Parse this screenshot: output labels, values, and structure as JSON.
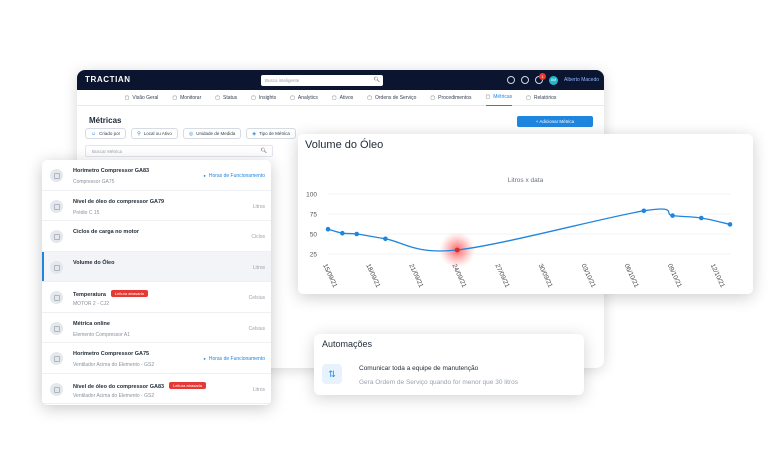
{
  "topbar": {
    "logo": "TRACTIAN",
    "search_placeholder": "Busca inteligente",
    "notifications_badge": "1",
    "avatar_initials": "AM",
    "user_name": "Alberto Macedo"
  },
  "nav": {
    "items": [
      {
        "label": "Visão Geral",
        "icon": "monitor-icon"
      },
      {
        "label": "Monitorar",
        "icon": "eye-icon"
      },
      {
        "label": "Status",
        "icon": "status-icon"
      },
      {
        "label": "Insights",
        "icon": "insights-icon"
      },
      {
        "label": "Analytics",
        "icon": "analytics-icon"
      },
      {
        "label": "Ativos",
        "icon": "assets-icon"
      },
      {
        "label": "Ordens de Serviço",
        "icon": "work-order-icon"
      },
      {
        "label": "Procedimentos",
        "icon": "list-icon"
      },
      {
        "label": "Métricas",
        "icon": "metrics-icon"
      },
      {
        "label": "Relatórios",
        "icon": "reports-icon"
      }
    ],
    "active_index": 8
  },
  "metrics_page": {
    "title": "Métricas",
    "add_button": "+ Adicionar Métrica",
    "filters": [
      "Criado por",
      "Local ou Ativo",
      "Unidade de Medida",
      "Tipo de Métrica"
    ],
    "search_placeholder": "Buscar Métrica"
  },
  "metric_list": [
    {
      "title": "Horímetro Compressor GA83",
      "subtitle": "Compressor GA75",
      "unit": "Horas de Funcionamento",
      "unit_is_link": true,
      "tag": ""
    },
    {
      "title": "Nível de óleo do compressor GA79",
      "subtitle": "Prédio C 15",
      "unit": "Litros",
      "unit_is_link": false,
      "tag": ""
    },
    {
      "title": "Ciclos de carga no motor",
      "subtitle": "",
      "unit": "Ciclos",
      "unit_is_link": false,
      "tag": ""
    },
    {
      "title": "Volume do Óleo",
      "subtitle": "",
      "unit": "Litros",
      "unit_is_link": false,
      "tag": "",
      "active": true
    },
    {
      "title": "Temperatura",
      "subtitle": "MOTOR 2 - CJ2",
      "unit": "Celsius",
      "unit_is_link": false,
      "tag": "Leitura atrasada"
    },
    {
      "title": "Métrica online",
      "subtitle": "Elemento Compressor A1",
      "unit": "Celsius",
      "unit_is_link": false,
      "tag": ""
    },
    {
      "title": "Horímetro Compressor GA75",
      "subtitle": "Ventilador Acima do Elemento - GS2",
      "unit": "Horas de Funcionamento",
      "unit_is_link": true,
      "tag": ""
    },
    {
      "title": "Nível de óleo do compressor GA83",
      "subtitle": "Ventilador Acima do Elemento - GS2",
      "unit": "Litros",
      "unit_is_link": false,
      "tag": "Leitura atrasada"
    }
  ],
  "chart_card": {
    "title": "Volume do Óleo",
    "subtitle": "Litros x data"
  },
  "chart_data": {
    "type": "line",
    "title": "Volume do Óleo",
    "subtitle": "Litros x data",
    "xlabel": "",
    "ylabel": "",
    "ylim": [
      25,
      100
    ],
    "yticks": [
      100,
      75,
      50,
      25
    ],
    "categories": [
      "15/09/21",
      "18/09/21",
      "21/09/21",
      "24/09/21",
      "27/09/21",
      "30/09/21",
      "03/10/21",
      "06/10/21",
      "09/10/21",
      "12/10/21"
    ],
    "grid": true,
    "series": [
      {
        "color": "#1f86e0",
        "points": [
          {
            "x": "15/09/21",
            "y": 56
          },
          {
            "x": "16/09/21",
            "y": 51
          },
          {
            "x": "17/09/21",
            "y": 50
          },
          {
            "x": "19/09/21",
            "y": 44
          },
          {
            "x": "24/09/21",
            "y": 30
          },
          {
            "x": "07/10/21",
            "y": 79
          },
          {
            "x": "09/10/21",
            "y": 73
          },
          {
            "x": "11/10/21",
            "y": 70
          },
          {
            "x": "13/10/21",
            "y": 62
          }
        ],
        "highlighted_point": "24/09/21"
      }
    ]
  },
  "automation": {
    "title": "Automações",
    "item_title": "Comunicar toda a equipe de manutenção",
    "item_subtitle": "Gera Ordem de Serviço quando for menor que 30 litros"
  },
  "colors": {
    "brand_dark": "#0b1530",
    "accent": "#1f86e0",
    "alert": "#e53935"
  }
}
